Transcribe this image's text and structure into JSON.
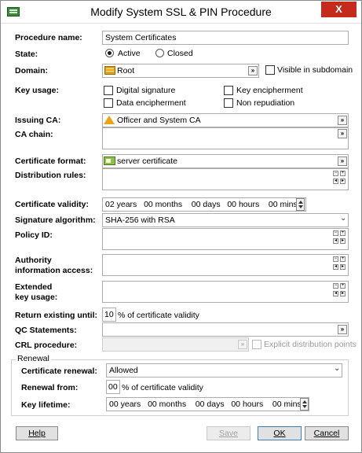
{
  "window": {
    "title": "Modify System SSL & PIN Procedure",
    "close": "X"
  },
  "procedure_name": {
    "label": "Procedure name:",
    "value": "System Certificates"
  },
  "state": {
    "label": "State:",
    "options": [
      "Active",
      "Closed"
    ],
    "selected": "Active"
  },
  "domain": {
    "label": "Domain:",
    "value": "Root",
    "visible_label": "Visible in subdomain"
  },
  "key_usage": {
    "label": "Key usage:",
    "options": [
      "Digital signature",
      "Key encipherment",
      "Data encipherment",
      "Non repudiation"
    ]
  },
  "issuing_ca": {
    "label": "Issuing CA:",
    "value": "Officer and System CA"
  },
  "ca_chain": {
    "label": "CA chain:"
  },
  "certificate_format": {
    "label": "Certificate format:",
    "value": "server certificate"
  },
  "distribution_rules": {
    "label": "Distribution rules:"
  },
  "certificate_validity": {
    "label": "Certificate validity:",
    "years": "02",
    "years_unit": "years",
    "months": "00",
    "months_unit": "months",
    "days": "00",
    "days_unit": "days",
    "hours": "00",
    "hours_unit": "hours",
    "mins": "00",
    "mins_unit": "mins"
  },
  "signature_algorithm": {
    "label": "Signature algorithm:",
    "value": "SHA-256 with RSA"
  },
  "policy_id": {
    "label": "Policy ID:"
  },
  "authority_info": {
    "label_line1": "Authority",
    "label_line2": "information access:"
  },
  "extended_key_usage": {
    "label_line1": "Extended",
    "label_line2": "key usage:"
  },
  "return_existing": {
    "label": "Return existing until:",
    "value": "10",
    "suffix": "% of certificate validity"
  },
  "qc_statements": {
    "label": "QC Statements:"
  },
  "crl_procedure": {
    "label": "CRL procedure:",
    "checkbox_label": "Explicit distribution points"
  },
  "renewal": {
    "legend": "Renewal",
    "certificate_renewal": {
      "label": "Certificate renewal:",
      "value": "Allowed"
    },
    "renewal_from": {
      "label": "Renewal from:",
      "value": "00",
      "suffix": "% of certificate validity"
    },
    "key_lifetime": {
      "label": "Key lifetime:",
      "years": "00",
      "years_unit": "years",
      "months": "00",
      "months_unit": "months",
      "days": "00",
      "days_unit": "days",
      "hours": "00",
      "hours_unit": "hours",
      "mins": "00",
      "mins_unit": "mins"
    }
  },
  "buttons": {
    "help": "Help",
    "save": "Save",
    "ok": "OK",
    "cancel": "Cancel"
  },
  "icons": {
    "picker": "»",
    "plus": "+",
    "minus": "−",
    "left": "◂",
    "right": "▸",
    "dropdown": "⌄"
  }
}
